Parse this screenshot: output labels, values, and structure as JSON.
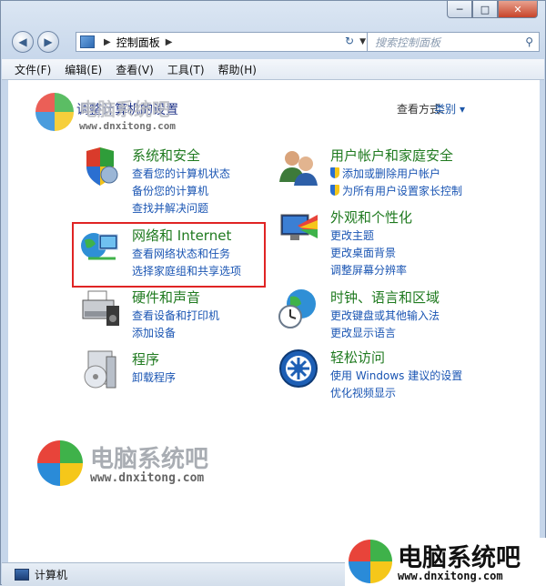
{
  "window": {
    "minimize": "─",
    "maximize": "□",
    "close": "✕"
  },
  "nav": {
    "address_path": "控制面板",
    "search_placeholder": "搜索控制面板"
  },
  "menu": [
    "文件(F)",
    "编辑(E)",
    "查看(V)",
    "工具(T)",
    "帮助(H)"
  ],
  "main": {
    "heading": "调整计算机的设置",
    "view_by_label": "查看方式:",
    "view_by_value": "类别 ▾"
  },
  "categories": [
    {
      "title": "系统和安全",
      "links": [
        "查看您的计算机状态",
        "备份您的计算机",
        "查找并解决问题"
      ],
      "icon": "shield-icon"
    },
    {
      "title": "网络和 Internet",
      "links": [
        "查看网络状态和任务",
        "选择家庭组和共享选项"
      ],
      "icon": "network-icon"
    },
    {
      "title": "硬件和声音",
      "links": [
        "查看设备和打印机",
        "添加设备"
      ],
      "icon": "printer-icon"
    },
    {
      "title": "程序",
      "links": [
        "卸载程序"
      ],
      "icon": "programs-icon"
    },
    {
      "title": "用户帐户和家庭安全",
      "links": [
        "添加或删除用户帐户",
        "为所有用户设置家长控制"
      ],
      "icon": "users-icon"
    },
    {
      "title": "外观和个性化",
      "links": [
        "更改主题",
        "更改桌面背景",
        "调整屏幕分辨率"
      ],
      "icon": "appearance-icon"
    },
    {
      "title": "时钟、语言和区域",
      "links": [
        "更改键盘或其他输入法",
        "更改显示语言"
      ],
      "icon": "clock-globe-icon"
    },
    {
      "title": "轻松访问",
      "links": [
        "使用 Windows 建议的设置",
        "优化视频显示"
      ],
      "icon": "ease-of-access-icon"
    }
  ],
  "statusbar": {
    "text": "计算机"
  },
  "watermark": {
    "cn": "电脑系统吧",
    "url": "www.dnxitong.com"
  },
  "colors": {
    "category_title": "#1f7a1f",
    "link": "#1a55b3",
    "heading": "#1e3287",
    "highlight_box": "#e02424"
  }
}
